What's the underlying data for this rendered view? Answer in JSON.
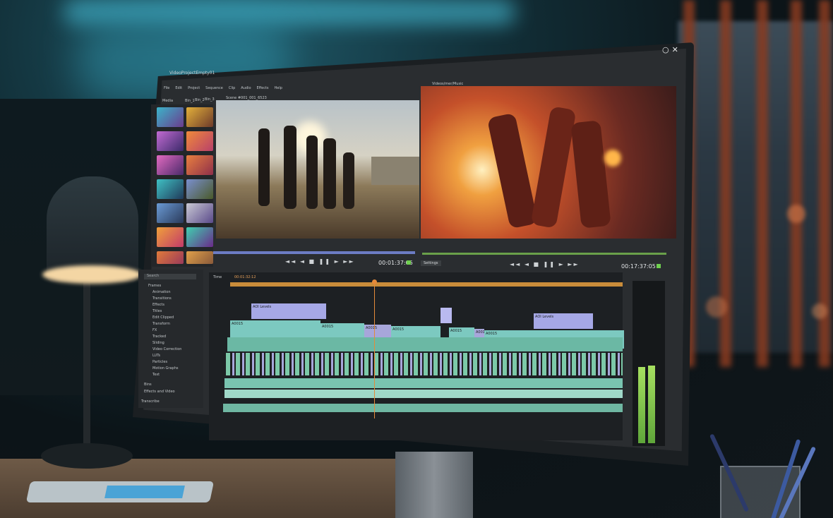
{
  "app": {
    "title": "VideoProjectEmpty01",
    "menu": [
      "File",
      "Edit",
      "Project",
      "Sequence",
      "Clip",
      "Audio",
      "Effects",
      "Help"
    ],
    "window_controls": "○✕"
  },
  "media_panel": {
    "title": "Media",
    "tabs": [
      "Bin_1",
      "Bin_2",
      "Bin_3"
    ]
  },
  "source_viewer": {
    "title": "Scene #001_001_6523",
    "timecode": "00:01:37:05"
  },
  "program_viewer": {
    "title": "Videos/mer/Music",
    "timecode": "00:17:37:05",
    "settings_label": "Settings"
  },
  "playback_controls": "◄◄ ◄ ■ ❚❚ ► ►►",
  "project_panel": {
    "search_placeholder": "Search",
    "folders": [
      "Frames",
      "Animation",
      "Transitions",
      "Effects",
      "Titles",
      "Edit Clipped",
      "Transform",
      "FX",
      "Tracked",
      "Sliding",
      "Video Correction",
      "LUTs",
      "Particles",
      "Motion Graphs",
      "Text"
    ],
    "bottom_items": [
      "Bins",
      "Effects and Video"
    ],
    "footer": "Transcribe"
  },
  "timeline": {
    "label": "Time",
    "timecode": "00:01:32:12",
    "clips": {
      "audio_levels_1": "AOI Levels",
      "audio_levels_2": "AOI Levels",
      "a1": "A0015",
      "a2": "A0015",
      "a3": "A0015",
      "a4": "A0015",
      "a5": "A0015",
      "a6": "A0015",
      "a7": "A0015"
    }
  },
  "colors": {
    "timeline_teal": "#7cc9c0",
    "clip_purple": "#9a9ad8",
    "playhead": "#e48a3a",
    "meter_green": "#8fd451"
  }
}
